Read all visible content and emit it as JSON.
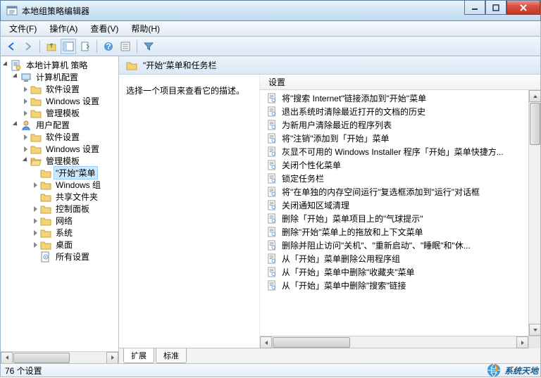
{
  "window": {
    "title": "本地组策略编辑器"
  },
  "menubar": [
    "文件(F)",
    "操作(A)",
    "查看(V)",
    "帮助(H)"
  ],
  "tree": [
    {
      "indent": 0,
      "expand": "expanded",
      "icon": "doc",
      "label": "本地计算机 策略"
    },
    {
      "indent": 1,
      "expand": "expanded",
      "icon": "computer",
      "label": "计算机配置"
    },
    {
      "indent": 2,
      "expand": "collapsed",
      "icon": "folder",
      "label": "软件设置"
    },
    {
      "indent": 2,
      "expand": "collapsed",
      "icon": "folder",
      "label": "Windows 设置"
    },
    {
      "indent": 2,
      "expand": "collapsed",
      "icon": "folder",
      "label": "管理模板"
    },
    {
      "indent": 1,
      "expand": "expanded",
      "icon": "user",
      "label": "用户配置"
    },
    {
      "indent": 2,
      "expand": "collapsed",
      "icon": "folder",
      "label": "软件设置"
    },
    {
      "indent": 2,
      "expand": "collapsed",
      "icon": "folder",
      "label": "Windows 设置"
    },
    {
      "indent": 2,
      "expand": "expanded",
      "icon": "folder-open",
      "label": "管理模板"
    },
    {
      "indent": 3,
      "expand": "none",
      "icon": "folder",
      "label": "\"开始\"菜单",
      "selected": true
    },
    {
      "indent": 3,
      "expand": "collapsed",
      "icon": "folder",
      "label": "Windows 组"
    },
    {
      "indent": 3,
      "expand": "none",
      "icon": "folder",
      "label": "共享文件夹"
    },
    {
      "indent": 3,
      "expand": "collapsed",
      "icon": "folder",
      "label": "控制面板"
    },
    {
      "indent": 3,
      "expand": "collapsed",
      "icon": "folder",
      "label": "网络"
    },
    {
      "indent": 3,
      "expand": "collapsed",
      "icon": "folder",
      "label": "系统"
    },
    {
      "indent": 3,
      "expand": "collapsed",
      "icon": "folder",
      "label": "桌面"
    },
    {
      "indent": 3,
      "expand": "none",
      "icon": "settings-doc",
      "label": "所有设置"
    }
  ],
  "detail": {
    "header_title": "\"开始\"菜单和任务栏",
    "description_prompt": "选择一个项目来查看它的描述。",
    "list_header": "设置",
    "items": [
      "将\"搜索 Internet\"链接添加到\"开始\"菜单",
      "退出系统时清除最近打开的文档的历史",
      "为新用户清除最近的程序列表",
      "将\"注销\"添加到「开始」菜单",
      "灰显不可用的 Windows Installer 程序「开始」菜单快捷方...",
      "关闭个性化菜单",
      "锁定任务栏",
      "将\"在单独的内存空间运行\"复选框添加到\"运行\"对话框",
      "关闭通知区域清理",
      "删除「开始」菜单项目上的\"气球提示\"",
      "删除\"开始\"菜单上的拖放和上下文菜单",
      "删除并阻止访问\"关机\"、\"重新启动\"、\"睡眠\"和\"休...",
      "从「开始」菜单删除公用程序组",
      "从「开始」菜单中删除\"收藏夹\"菜单",
      "从「开始」菜单中删除\"搜索\"链接"
    ],
    "tabs": [
      "扩展",
      "标准"
    ]
  },
  "statusbar": {
    "count_text": "76 个设置"
  },
  "watermark": "系统天地"
}
